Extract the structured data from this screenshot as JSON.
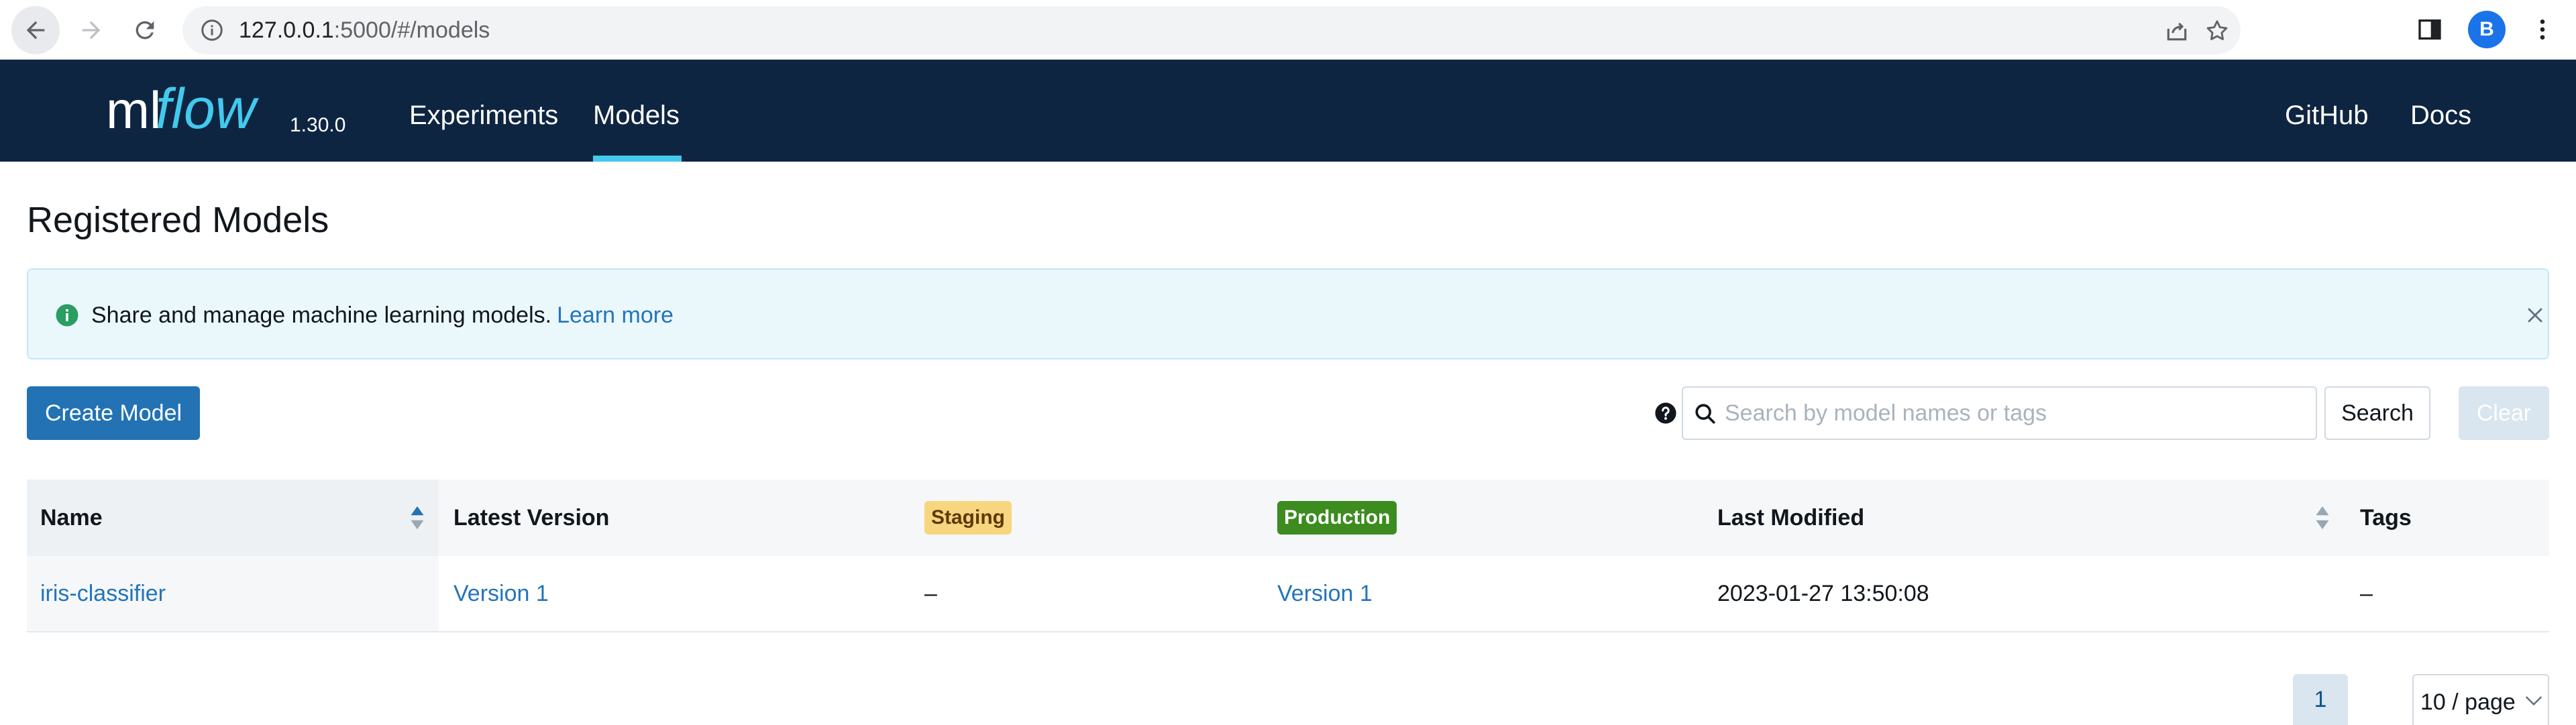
{
  "browser": {
    "url_host": "127.0.0.1",
    "url_rest": ":5000/#/models",
    "profile_initial": "B"
  },
  "header": {
    "logo_ml": "ml",
    "logo_flow": "flow",
    "version": "1.30.0",
    "nav": {
      "experiments": "Experiments",
      "models": "Models",
      "github": "GitHub",
      "docs": "Docs"
    },
    "active_tab": "Models"
  },
  "page": {
    "title": "Registered Models",
    "alert": {
      "message": "Share and manage machine learning models.",
      "link": "Learn more"
    },
    "create_button": "Create Model",
    "search": {
      "placeholder": "Search by model names or tags",
      "value": "",
      "button": "Search",
      "clear": "Clear"
    }
  },
  "table": {
    "columns": {
      "name": "Name",
      "latest_version": "Latest Version",
      "staging": "Staging",
      "production": "Production",
      "last_modified": "Last Modified",
      "tags": "Tags"
    },
    "rows": [
      {
        "name": "iris-classifier",
        "latest_version": "Version 1",
        "staging": "–",
        "production": "Version 1",
        "last_modified": "2023-01-27 13:50:08",
        "tags": "–"
      }
    ]
  },
  "pagination": {
    "current_page": "1",
    "page_size": "10 / page"
  },
  "colors": {
    "header_bg": "#0e2541",
    "primary": "#2272b4",
    "link": "#2374bb",
    "active_underline": "#43c9ed",
    "staging_tag": "#f8d57f",
    "production_tag": "#3c8c1f"
  }
}
